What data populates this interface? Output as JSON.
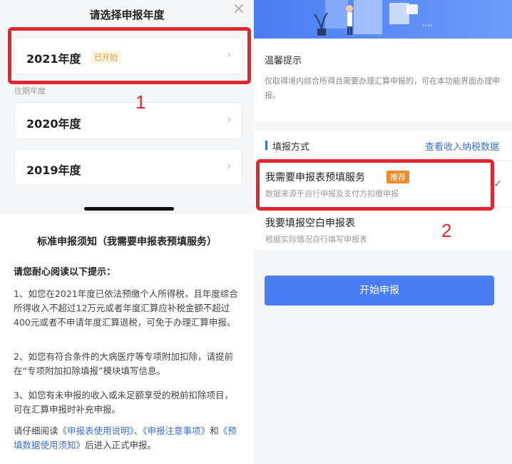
{
  "left": {
    "sheet_title": "请选择申报年度",
    "close_glyph": "✕",
    "past_label": "往期年度",
    "years": [
      {
        "label": "2021年度",
        "badge": "已开始"
      },
      {
        "label": "2020年度",
        "badge": ""
      },
      {
        "label": "2019年度",
        "badge": ""
      }
    ],
    "chevron_glyph": "›",
    "annotation_number": "1",
    "notice": {
      "title": "标准申报须知（我需要申报表预填服务）",
      "subtitle": "请您耐心阅读以下提示：",
      "p1": "1、如您在2021年度已依法预缴个人所得税，且年度综合所得收入不超过12万元或者年度汇算应补税金额不超过400元或者不申请年度汇算退税，可免于办理汇算申报。",
      "p2": "2、如您有符合条件的大病医疗等专项附加扣除，请提前在“专项附加扣除填报”模块填写信息。",
      "p3": "3、如您有未申报的收入或未足额享受的税前扣除项目，可在汇算申报时补充申报。",
      "p4_prefix": "请仔细阅读",
      "link1": "《申报表使用说明》",
      "sep1": "、",
      "link2": "《申报注意事项》",
      "sep2": "和",
      "link3": "《预填数据使用须知》",
      "p4_suffix": "后进入正式申报。"
    }
  },
  "right": {
    "tips_title": "温馨提示",
    "tips_body": "仅取得境内综合所得且需要办理汇算申报的，可在本功能界面办理申报。",
    "method_title": "填报方式",
    "method_link": "查看收入纳税数据",
    "option1": {
      "title": "我需要申报表预填服务",
      "badge": "推荐",
      "desc": "数据来源于自行申报及支付方扣缴申报"
    },
    "option2": {
      "title": "我要填报空白申报表",
      "desc": "根据实际情况自行填写申报表"
    },
    "check_glyph": "✓",
    "start_button": "开始申报",
    "annotation_number": "2"
  },
  "colors": {
    "accent": "#4a7df2",
    "annotation_red": "#e0272d",
    "link": "#3a6fd8",
    "badge_orange": "#f08a2b"
  }
}
